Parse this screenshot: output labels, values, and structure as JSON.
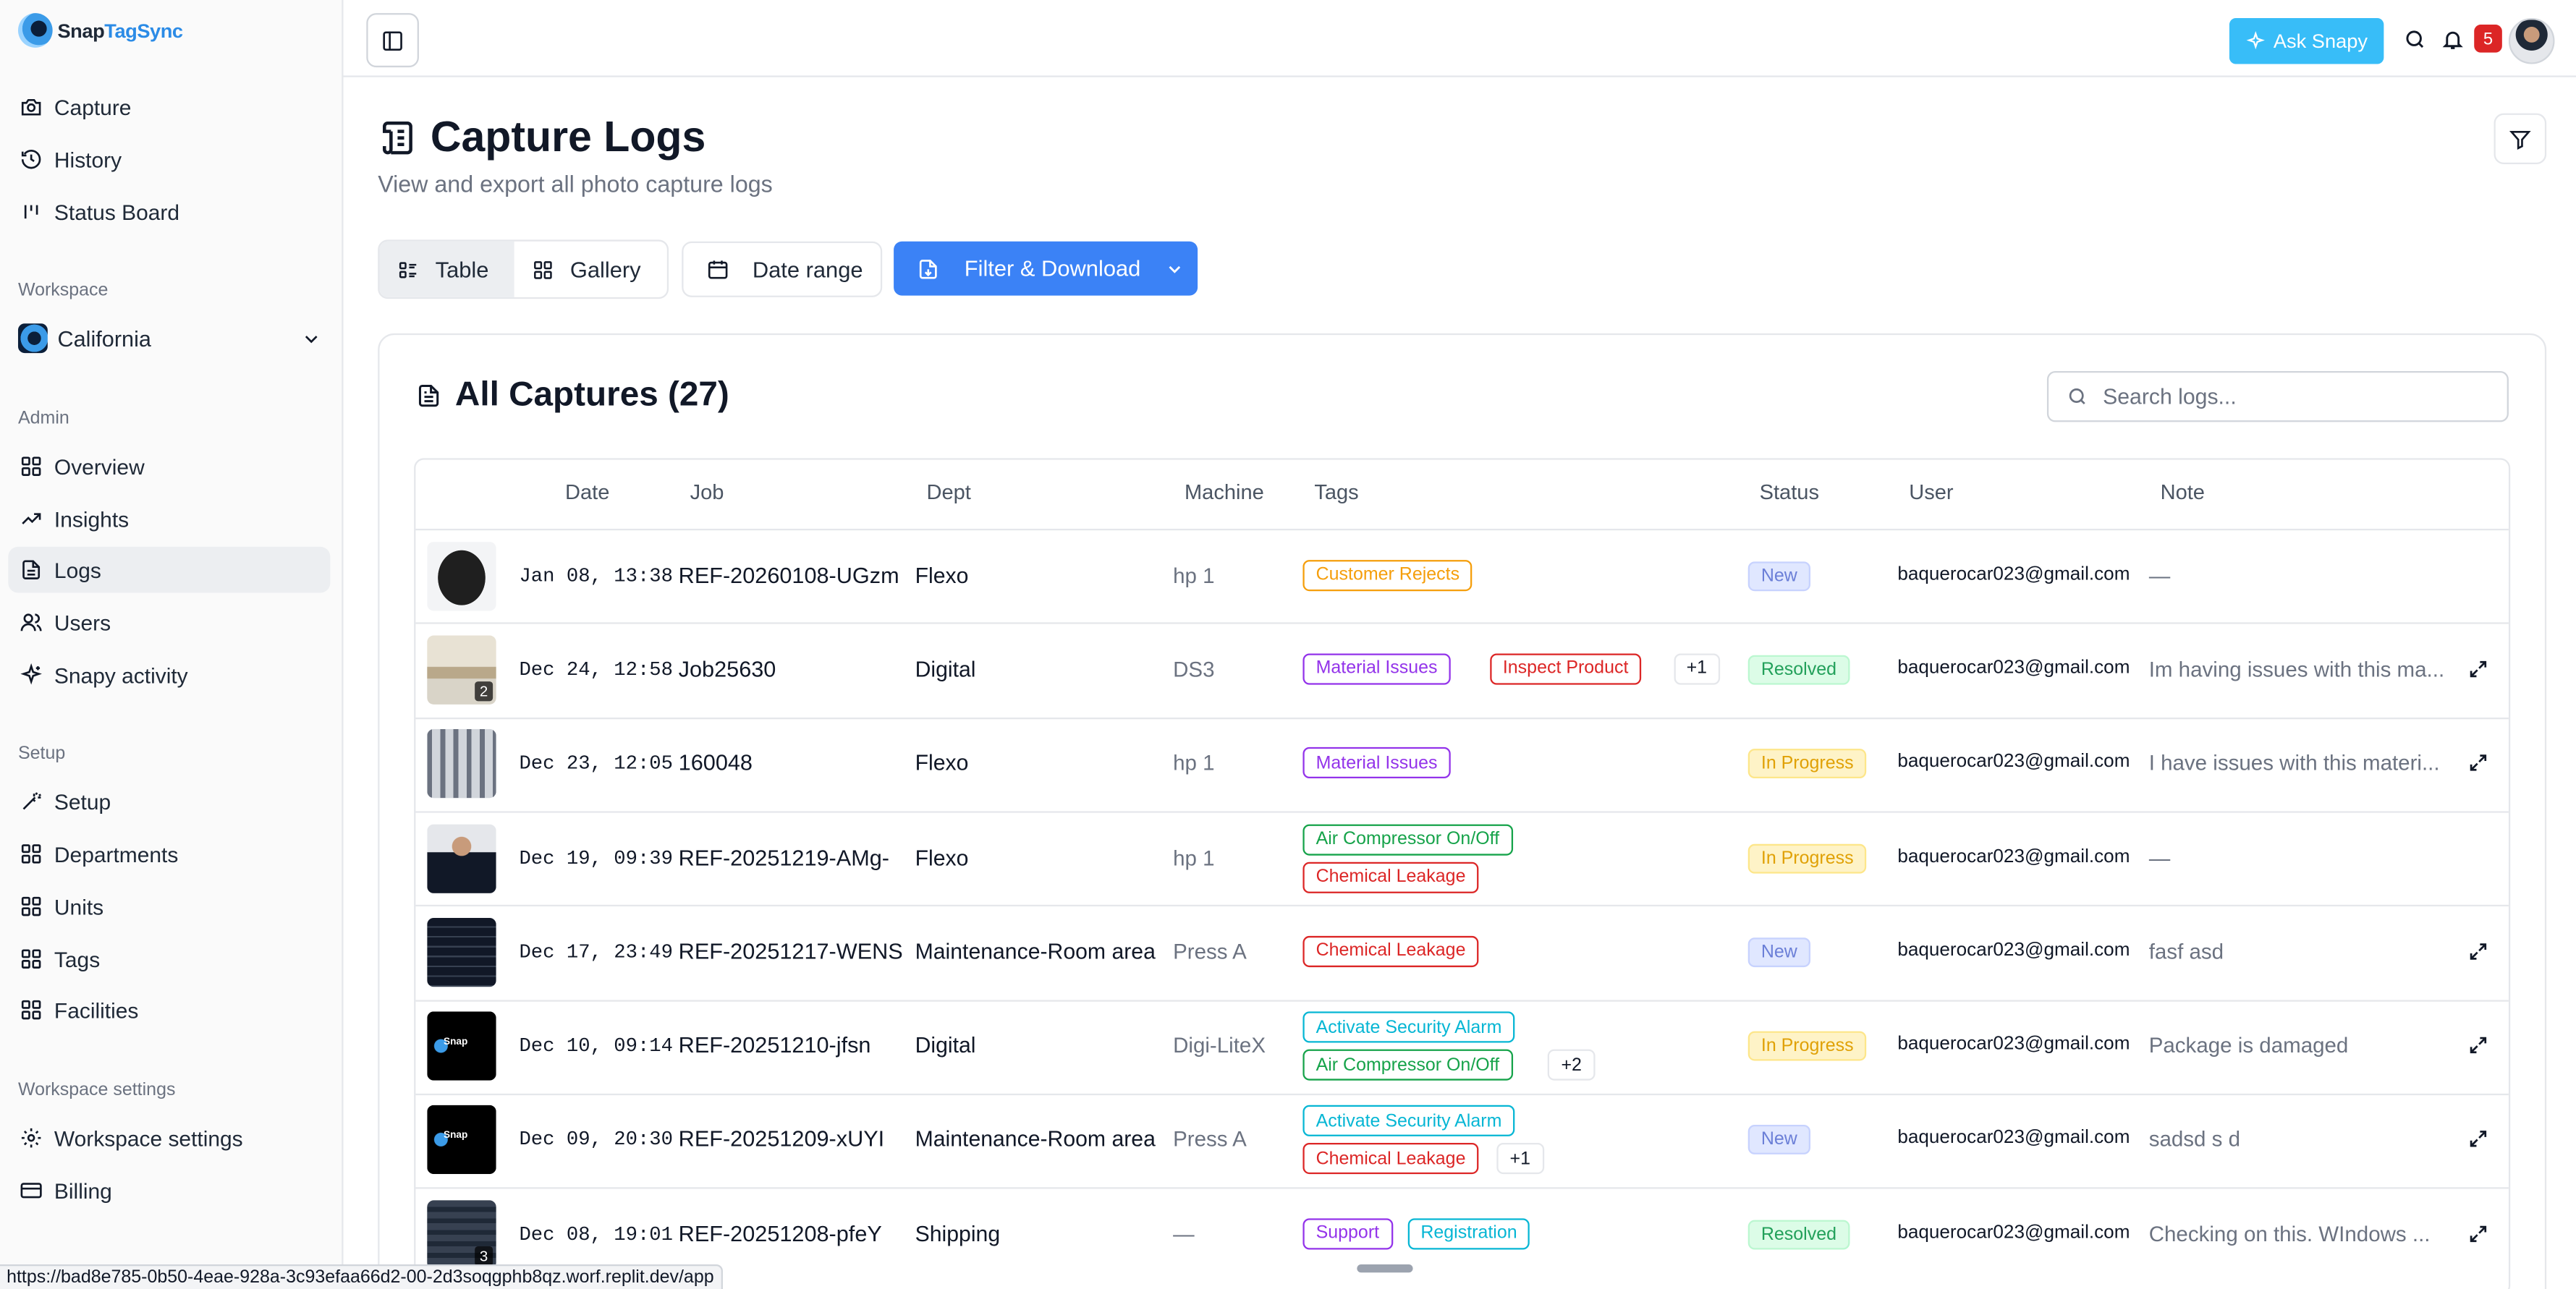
{
  "app": {
    "brand_a": "Snap",
    "brand_b": "TagSync"
  },
  "sidebar": {
    "main_items": [
      {
        "label": "Capture",
        "icon": "camera-icon"
      },
      {
        "label": "History",
        "icon": "history-icon"
      },
      {
        "label": "Status Board",
        "icon": "kanban-icon"
      }
    ],
    "workspace_title": "Workspace",
    "workspace_name": "California",
    "admin_title": "Admin",
    "admin_items": [
      {
        "label": "Overview",
        "icon": "grid-icon"
      },
      {
        "label": "Insights",
        "icon": "trend-icon"
      },
      {
        "label": "Logs",
        "icon": "file-icon",
        "active": true
      },
      {
        "label": "Users",
        "icon": "users-icon"
      },
      {
        "label": "Snapy activity",
        "icon": "sparkle-icon"
      }
    ],
    "setup_title": "Setup",
    "setup_items": [
      {
        "label": "Setup",
        "icon": "wand-icon"
      },
      {
        "label": "Departments",
        "icon": "grid-icon"
      },
      {
        "label": "Units",
        "icon": "grid-icon"
      },
      {
        "label": "Tags",
        "icon": "grid-icon"
      },
      {
        "label": "Facilities",
        "icon": "grid-icon"
      }
    ],
    "ws_settings_title": "Workspace settings",
    "ws_settings_items": [
      {
        "label": "Workspace settings",
        "icon": "gear-icon"
      },
      {
        "label": "Billing",
        "icon": "card-icon"
      }
    ]
  },
  "topbar": {
    "ask_label": "Ask Snapy",
    "notif_count": "5"
  },
  "page": {
    "title": "Capture Logs",
    "subtitle": "View and export all photo capture logs",
    "view_table": "Table",
    "view_gallery": "Gallery",
    "date_range": "Date range",
    "filter_download": "Filter & Download"
  },
  "card": {
    "title": "All Captures (27)",
    "search_placeholder": "Search logs..."
  },
  "columns": [
    "Date",
    "Job",
    "Dept",
    "Machine",
    "Tags",
    "Status",
    "User",
    "Note"
  ],
  "rows": [
    {
      "date": "Jan 08, 13:38",
      "job": "REF-20260108-UGzm",
      "dept": "Flexo",
      "machine": "hp 1",
      "tags": [
        {
          "label": "Customer Rejects",
          "color": "#f59e0b"
        }
      ],
      "more": "",
      "status": "New",
      "user": "baquerocar023@gmail.com",
      "note": "—",
      "thumb": "speaker",
      "count": "",
      "expand": false
    },
    {
      "date": "Dec 24, 12:58",
      "job": "Job25630",
      "dept": "Digital",
      "machine": "DS3",
      "tags": [
        {
          "label": "Material Issues",
          "color": "#9333ea"
        },
        {
          "label": "Inspect Product",
          "color": "#dc2626"
        }
      ],
      "more": "+1",
      "status": "Resolved",
      "user": "baquerocar023@gmail.com",
      "note": "Im having issues with this ma...",
      "thumb": "room",
      "count": "2",
      "expand": true
    },
    {
      "date": "Dec 23, 12:05",
      "job": "160048",
      "dept": "Flexo",
      "machine": "hp 1",
      "tags": [
        {
          "label": "Material Issues",
          "color": "#9333ea"
        }
      ],
      "more": "",
      "status": "In Progress",
      "user": "baquerocar023@gmail.com",
      "note": "I have issues with this materi...",
      "thumb": "factory",
      "count": "",
      "expand": true
    },
    {
      "date": "Dec 19, 09:39",
      "job": "REF-20251219-AMg-",
      "dept": "Flexo",
      "machine": "hp 1",
      "tags": [
        {
          "label": "Air Compressor On/Off",
          "color": "#16a34a"
        },
        {
          "label": "Chemical Leakage",
          "color": "#dc2626"
        }
      ],
      "more": "",
      "status": "In Progress",
      "user": "baquerocar023@gmail.com",
      "note": "—",
      "thumb": "person",
      "count": "",
      "expand": false
    },
    {
      "date": "Dec 17, 23:49",
      "job": "REF-20251217-WENS",
      "dept": "Maintenance-Room area",
      "machine": "Press A",
      "tags": [
        {
          "label": "Chemical Leakage",
          "color": "#dc2626"
        }
      ],
      "more": "",
      "status": "New",
      "user": "baquerocar023@gmail.com",
      "note": "fasf asd",
      "thumb": "dark",
      "count": "",
      "expand": true
    },
    {
      "date": "Dec 10, 09:14",
      "job": "REF-20251210-jfsn",
      "dept": "Digital",
      "machine": "Digi-LiteX",
      "tags": [
        {
          "label": "Activate Security Alarm",
          "color": "#06b6d4"
        },
        {
          "label": "Air Compressor On/Off",
          "color": "#16a34a"
        }
      ],
      "more": "+2",
      "status": "In Progress",
      "user": "baquerocar023@gmail.com",
      "note": "Package is damaged",
      "thumb": "logo",
      "count": "",
      "expand": true
    },
    {
      "date": "Dec 09, 20:30",
      "job": "REF-20251209-xUYI",
      "dept": "Maintenance-Room area",
      "machine": "Press A",
      "tags": [
        {
          "label": "Activate Security Alarm",
          "color": "#06b6d4"
        },
        {
          "label": "Chemical Leakage",
          "color": "#dc2626"
        }
      ],
      "more": "+1",
      "status": "New",
      "user": "baquerocar023@gmail.com",
      "note": "sadsd s d",
      "thumb": "logo",
      "count": "",
      "expand": true
    },
    {
      "date": "Dec 08, 19:01",
      "job": "REF-20251208-pfeY",
      "dept": "Shipping",
      "machine": "—",
      "tags": [
        {
          "label": "Support",
          "color": "#9333ea"
        },
        {
          "label": "Registration",
          "color": "#06b6d4"
        }
      ],
      "more": "",
      "status": "Resolved",
      "user": "baquerocar023@gmail.com",
      "note": "Checking on this. WIndows ...",
      "thumb": "screen",
      "count": "3",
      "expand": true
    }
  ],
  "status_colors": {
    "New": {
      "bg": "#e0e7ff",
      "fg": "#6b7fd7",
      "bd": "#c7d2fe"
    },
    "Resolved": {
      "bg": "#dcfce7",
      "fg": "#22a05a",
      "bd": "#bbf7d0"
    },
    "In Progress": {
      "bg": "#fef3c7",
      "fg": "#e0a106",
      "bd": "#fde68a"
    }
  },
  "footer": {
    "url": "https://bad8e785-0b50-4eae-928a-3c93efaa66d2-00-2d3soqgphb8qz.worf.replit.dev/app"
  }
}
